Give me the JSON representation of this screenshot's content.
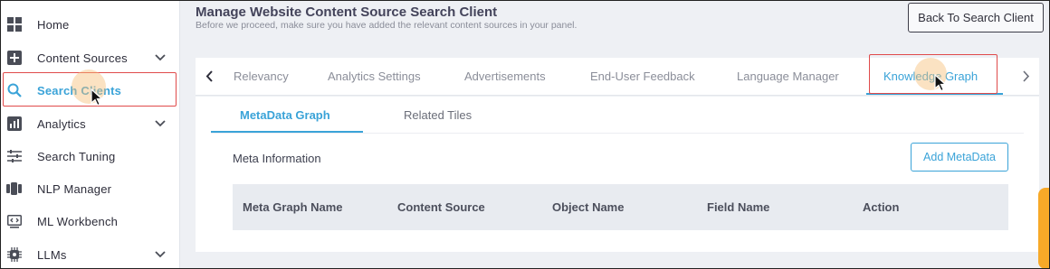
{
  "sidebar": {
    "items": [
      {
        "label": "Home",
        "icon": "home-grid-icon",
        "has_chevron": false
      },
      {
        "label": "Content Sources",
        "icon": "plus-square-icon",
        "has_chevron": true
      },
      {
        "label": "Search Clients",
        "icon": "search-icon",
        "has_chevron": false,
        "active": true
      },
      {
        "label": "Analytics",
        "icon": "analytics-chart-icon",
        "has_chevron": true
      },
      {
        "label": "Search Tuning",
        "icon": "sliders-icon",
        "has_chevron": false
      },
      {
        "label": "NLP Manager",
        "icon": "nlp-icon",
        "has_chevron": false
      },
      {
        "label": "ML Workbench",
        "icon": "code-monitor-icon",
        "has_chevron": false
      },
      {
        "label": "LLMs",
        "icon": "llm-chip-icon",
        "has_chevron": true
      }
    ]
  },
  "header": {
    "title": "Manage Website Content Source Search Client",
    "subtitle": "Before we proceed, make sure you have added the relevant content sources in your panel.",
    "back_button": "Back To Search Client"
  },
  "tabs": {
    "items": [
      "Relevancy",
      "Analytics Settings",
      "Advertisements",
      "End-User Feedback",
      "Language Manager",
      "Knowledge Graph"
    ],
    "active": "Knowledge Graph"
  },
  "subtabs": {
    "items": [
      "MetaData Graph",
      "Related Tiles"
    ],
    "active": "MetaData Graph"
  },
  "section": {
    "title": "Meta Information",
    "add_button": "Add MetaData"
  },
  "table": {
    "columns": [
      "Meta Graph Name",
      "Content Source",
      "Object Name",
      "Field Name",
      "Action"
    ],
    "rows": []
  },
  "colors": {
    "accent": "#3aa3d8",
    "highlight_border": "#e04b4b",
    "float_tab": "#f7a928"
  }
}
